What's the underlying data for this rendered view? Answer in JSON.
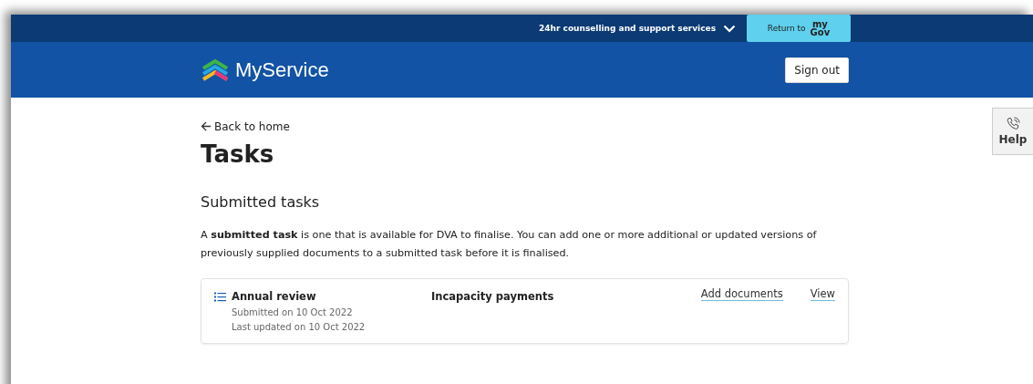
{
  "utility_bar": {
    "support_menu": "24hr counselling and support services",
    "return_button": {
      "label": "Return to",
      "logo_top": "my",
      "logo_bottom": "Gov"
    }
  },
  "header": {
    "brand": "MyService",
    "sign_out": "Sign out"
  },
  "back_link": "Back to home",
  "title": "Tasks",
  "section_title": "Submitted tasks",
  "intro": "A **submitted task** is one that is available for DVA to finalise. You can add one or more additional or updated versions of previously supplied documents to a submitted task before it is finalised.",
  "tasks": [
    {
      "name": "Annual review",
      "submitted": "Submitted on 10 Oct 2022",
      "updated": "Last updated on 10 Oct 2022",
      "category": "Incapacity payments",
      "actions": [
        "Add documents",
        "View"
      ]
    }
  ],
  "help_button": "Help"
}
